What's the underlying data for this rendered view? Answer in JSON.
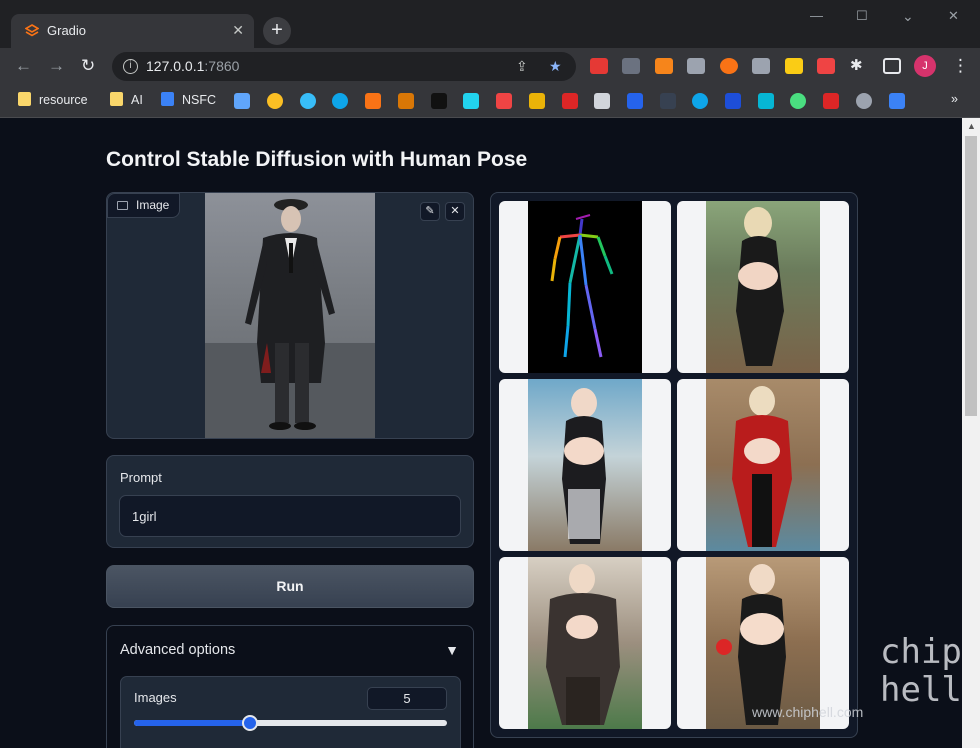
{
  "browser": {
    "tab_title": "Gradio",
    "tab_close": "✕",
    "new_tab": "+",
    "url_host": "127.0.0.1",
    "url_port": ":7860",
    "avatar_initial": "J",
    "window_controls": [
      "—",
      "☐",
      "✕"
    ]
  },
  "bookmarks": [
    {
      "label": "resource"
    },
    {
      "label": "AI"
    },
    {
      "label": "NSFC"
    }
  ],
  "page": {
    "title": "Control Stable Diffusion with Human Pose"
  },
  "image_input": {
    "label": "Image",
    "edit_icon": "✎",
    "clear_icon": "✕"
  },
  "prompt": {
    "label": "Prompt",
    "value": "1girl"
  },
  "run_button": {
    "label": "Run"
  },
  "advanced": {
    "label": "Advanced options",
    "arrow": "▼",
    "images_label": "Images",
    "images_value": "5",
    "images_slider_fraction": 0.37
  },
  "gallery": {
    "item_count": 6
  },
  "watermark": {
    "text": "www.chiphell.com",
    "logo_line1": "chip",
    "logo_line2": "hell"
  },
  "colors": {
    "accent": "#2563eb",
    "page_bg": "#0b0f19",
    "panel_bg": "#1f2937"
  }
}
